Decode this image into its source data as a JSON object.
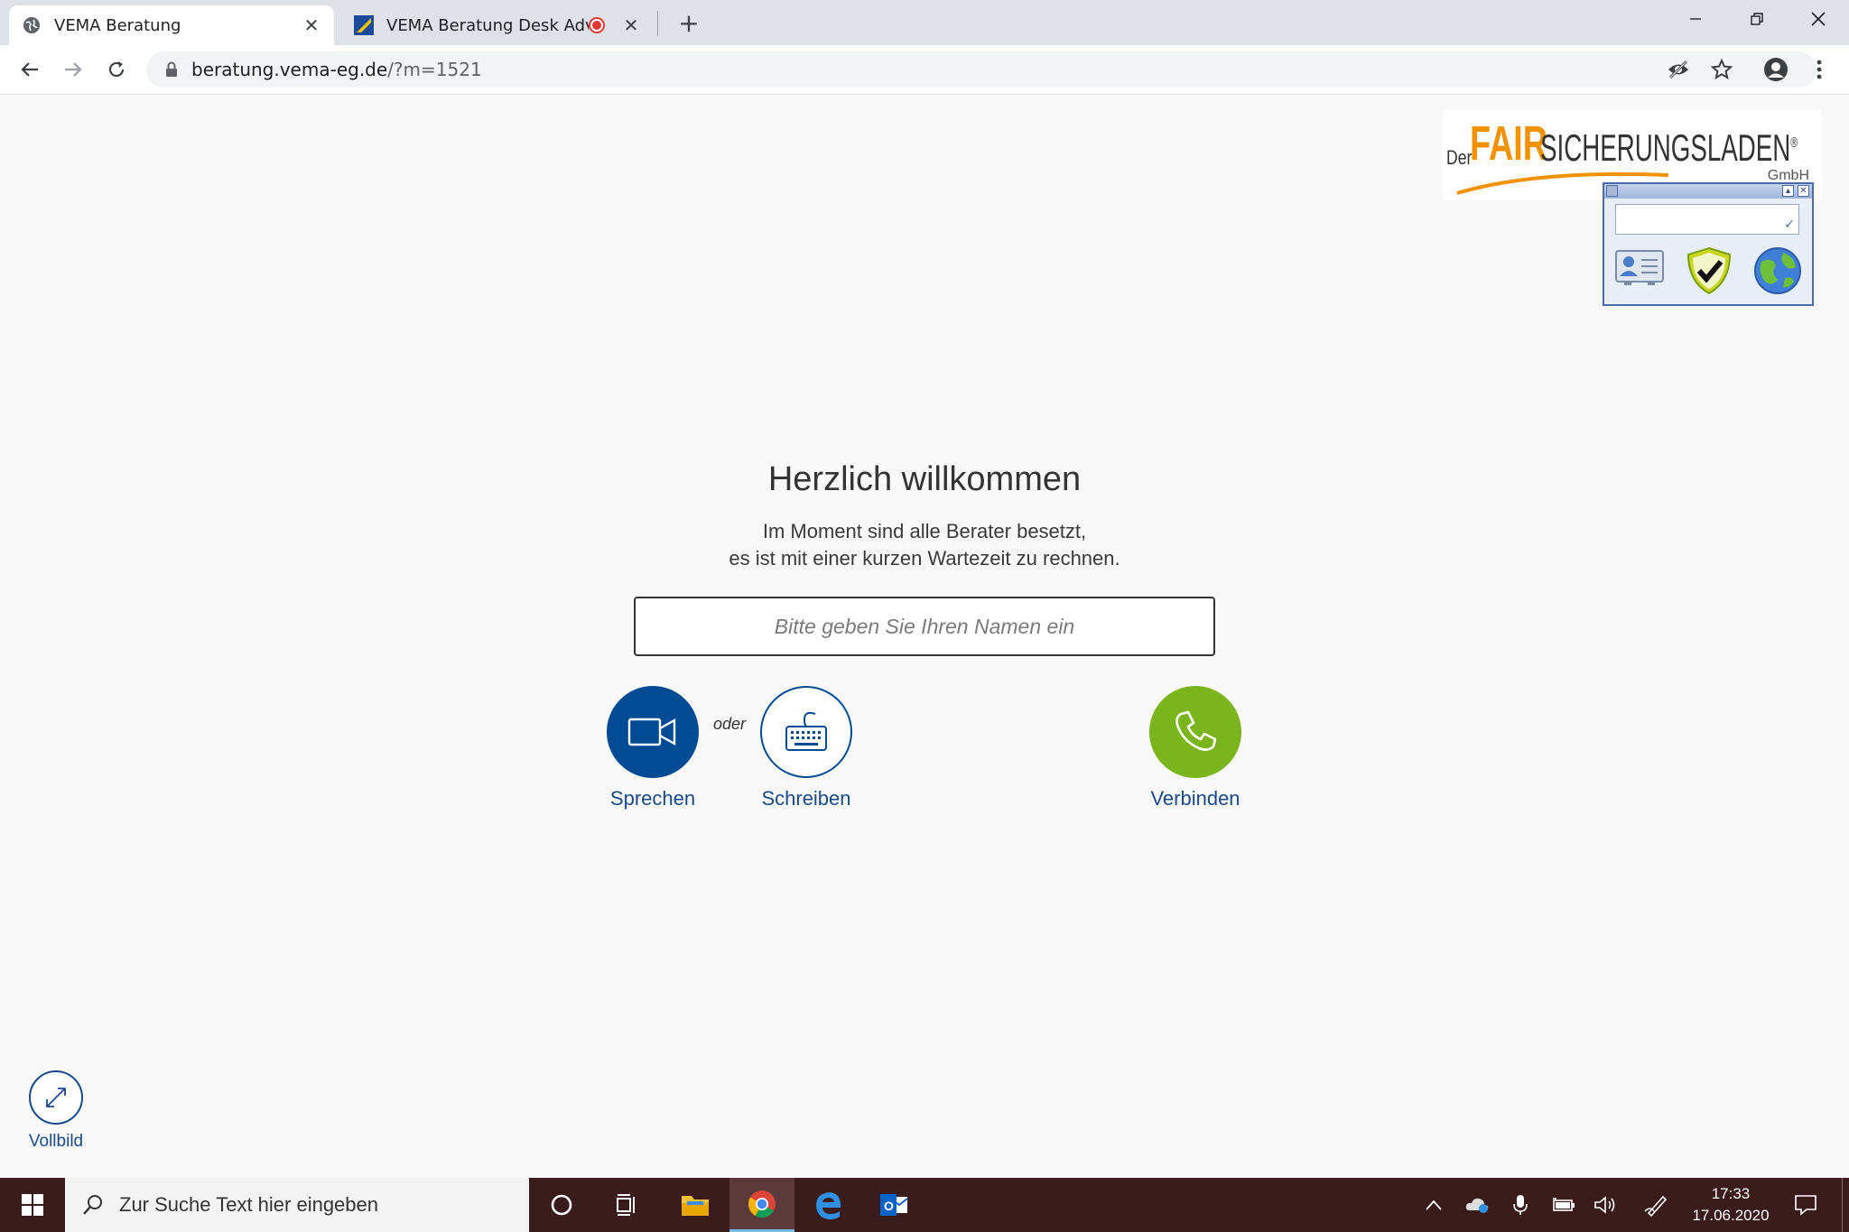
{
  "browser": {
    "tabs": [
      {
        "title": "VEMA Beratung",
        "active": true,
        "icon": "globe-icon"
      },
      {
        "title": "VEMA Beratung Desk Advise",
        "active": false,
        "icon": "vema-favicon",
        "recording": true
      }
    ],
    "url_host": "beratung.vema-eg.de",
    "url_path": "/?m=1521"
  },
  "logo": {
    "prefix": "Der",
    "accent": "FAIR",
    "name": "SICHERUNGSLADEN",
    "reg": "®",
    "suffix": "GmbH",
    "accent_color": "#f39200"
  },
  "main": {
    "heading": "Herzlich willkommen",
    "line1": "Im Moment sind alle Berater besetzt,",
    "line2": "es ist mit einer kurzen Wartezeit zu rechnen.",
    "name_placeholder": "Bitte geben Sie Ihren Namen ein",
    "oder": "oder",
    "speak_label": "Sprechen",
    "write_label": "Schreiben",
    "connect_label": "Verbinden",
    "fullscreen_label": "Vollbild",
    "colors": {
      "primary": "#004b93",
      "connect": "#7ab51d",
      "label": "#1a4a8a"
    }
  },
  "taskbar": {
    "search_placeholder": "Zur Suche Text hier eingeben",
    "time": "17:33",
    "date": "17.06.2020",
    "apps": [
      "cortana-icon",
      "task-view-icon",
      "file-explorer-icon",
      "chrome-icon",
      "edge-icon",
      "outlook-icon"
    ]
  }
}
